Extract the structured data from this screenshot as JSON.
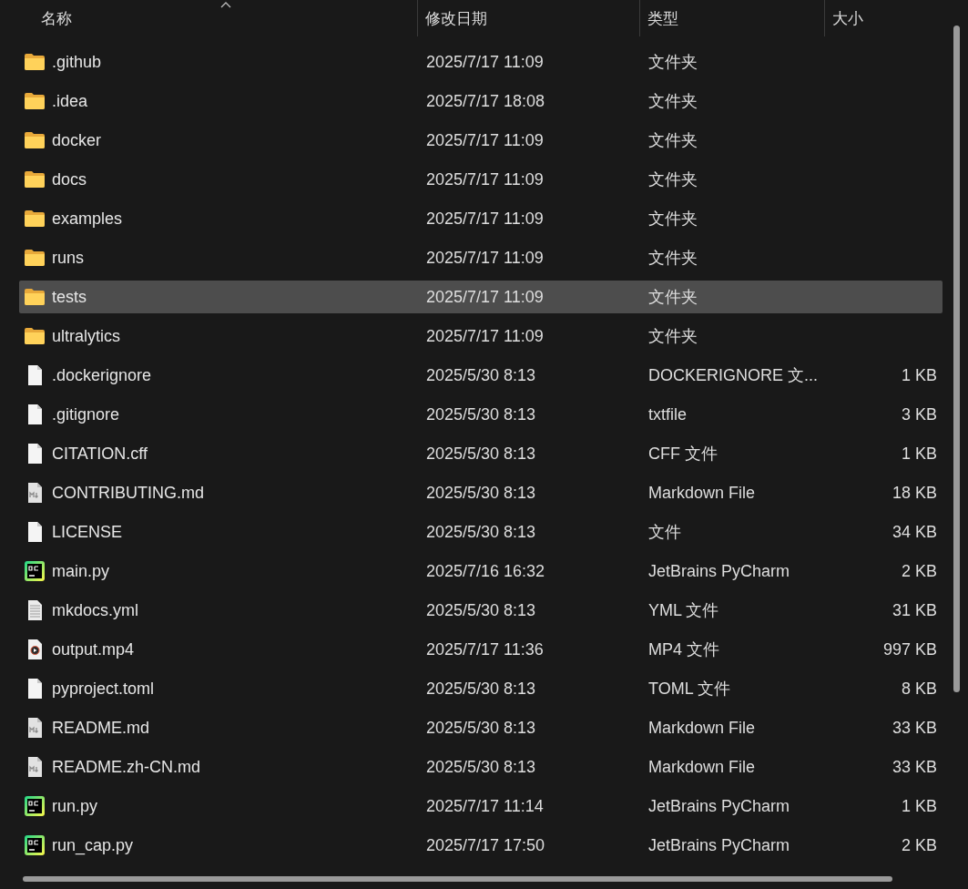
{
  "header": {
    "columns": [
      {
        "label": "名称",
        "sorted": true
      },
      {
        "label": "修改日期",
        "sorted": false
      },
      {
        "label": "类型",
        "sorted": false
      },
      {
        "label": "大小",
        "sorted": false
      }
    ]
  },
  "files": [
    {
      "name": ".github",
      "date": "2025/7/17 11:09",
      "type": "文件夹",
      "kind": "folder",
      "selected": false
    },
    {
      "name": ".idea",
      "date": "2025/7/17 18:08",
      "type": "文件夹",
      "kind": "folder",
      "selected": false
    },
    {
      "name": "docker",
      "date": "2025/7/17 11:09",
      "type": "文件夹",
      "kind": "folder",
      "selected": false
    },
    {
      "name": "docs",
      "date": "2025/7/17 11:09",
      "type": "文件夹",
      "kind": "folder",
      "selected": false
    },
    {
      "name": "examples",
      "date": "2025/7/17 11:09",
      "type": "文件夹",
      "kind": "folder",
      "selected": false
    },
    {
      "name": "runs",
      "date": "2025/7/17 11:09",
      "type": "文件夹",
      "kind": "folder",
      "selected": false
    },
    {
      "name": "tests",
      "date": "2025/7/17 11:09",
      "type": "文件夹",
      "kind": "folder",
      "selected": true
    },
    {
      "name": "ultralytics",
      "date": "2025/7/17 11:09",
      "type": "文件夹",
      "kind": "folder",
      "selected": false
    },
    {
      "name": ".dockerignore",
      "date": "2025/5/30 8:13",
      "type": "DOCKERIGNORE 文...",
      "size": "1 KB",
      "kind": "file",
      "selected": false
    },
    {
      "name": ".gitignore",
      "date": "2025/5/30 8:13",
      "type": "txtfile",
      "size": "3 KB",
      "kind": "file",
      "selected": false
    },
    {
      "name": "CITATION.cff",
      "date": "2025/5/30 8:13",
      "type": "CFF 文件",
      "size": "1 KB",
      "kind": "file",
      "selected": false
    },
    {
      "name": "CONTRIBUTING.md",
      "date": "2025/5/30 8:13",
      "type": "Markdown File",
      "size": "18 KB",
      "kind": "markdown",
      "selected": false
    },
    {
      "name": "LICENSE",
      "date": "2025/5/30 8:13",
      "type": "文件",
      "size": "34 KB",
      "kind": "file",
      "selected": false
    },
    {
      "name": "main.py",
      "date": "2025/7/16 16:32",
      "type": "JetBrains PyCharm",
      "size": "2 KB",
      "kind": "python",
      "selected": false
    },
    {
      "name": "mkdocs.yml",
      "date": "2025/5/30 8:13",
      "type": "YML 文件",
      "size": "31 KB",
      "kind": "text",
      "selected": false
    },
    {
      "name": "output.mp4",
      "date": "2025/7/17 11:36",
      "type": "MP4 文件",
      "size": "997 KB",
      "kind": "video",
      "selected": false
    },
    {
      "name": "pyproject.toml",
      "date": "2025/5/30 8:13",
      "type": "TOML 文件",
      "size": "8 KB",
      "kind": "file",
      "selected": false
    },
    {
      "name": "README.md",
      "date": "2025/5/30 8:13",
      "type": "Markdown File",
      "size": "33 KB",
      "kind": "markdown",
      "selected": false
    },
    {
      "name": "README.zh-CN.md",
      "date": "2025/5/30 8:13",
      "type": "Markdown File",
      "size": "33 KB",
      "kind": "markdown",
      "selected": false
    },
    {
      "name": "run.py",
      "date": "2025/7/17 11:14",
      "type": "JetBrains PyCharm",
      "size": "1 KB",
      "kind": "python",
      "selected": false
    },
    {
      "name": "run_cap.py",
      "date": "2025/7/17 17:50",
      "type": "JetBrains PyCharm",
      "size": "2 KB",
      "kind": "python",
      "selected": false
    }
  ]
}
